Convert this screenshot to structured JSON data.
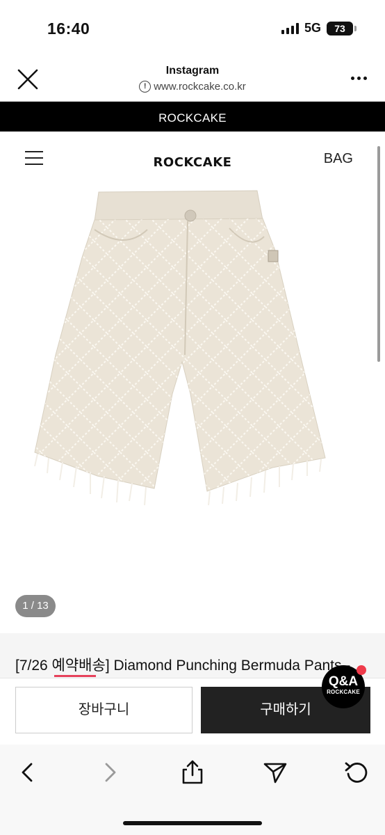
{
  "status_bar": {
    "time": "16:40",
    "network": "5G",
    "battery": "73"
  },
  "browser": {
    "title": "Instagram",
    "url": "www.rockcake.co.kr",
    "close_icon": "close-icon",
    "more_icon": "more-icon"
  },
  "banner": {
    "text": "ROCKCAKE"
  },
  "site_nav": {
    "logo": "ROCKCAKE",
    "bag": "BAG",
    "menu_icon": "hamburger-icon"
  },
  "product": {
    "image_counter": "1 / 13",
    "title": "[7/26 예약배송] Diamond Punching Bermuda Pants -"
  },
  "buy_bar": {
    "cart_label": "장바구니",
    "buy_label": "구매하기"
  },
  "qa_badge": {
    "label": "Q&A",
    "sublabel": "ROCKCAKE"
  },
  "colors": {
    "accent_red": "#e6415b",
    "buy_button": "#222222",
    "banner": "#000000"
  }
}
